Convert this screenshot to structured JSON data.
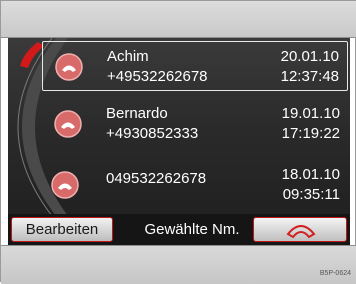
{
  "colors": {
    "accent": "#c01818",
    "screen": "#2a2a2a",
    "text": "#ffffff"
  },
  "calls": [
    {
      "name": "Achim",
      "number": "+49532262678",
      "date": "20.01.10",
      "time": "12:37:48",
      "selected": true,
      "icon": "phone-handset-icon"
    },
    {
      "name": "Bernardo",
      "number": "+4930852333",
      "date": "19.01.10",
      "time": "17:19:22",
      "selected": false,
      "icon": "phone-handset-icon"
    },
    {
      "name": "",
      "number": "049532262678",
      "date": "18.01.10",
      "time": "09:35:11",
      "selected": false,
      "icon": "phone-handset-icon"
    }
  ],
  "footer": {
    "edit_label": "Bearbeiten",
    "list_label": "Gewählte Nm.",
    "call_icon": "phone-handset-icon"
  },
  "image_code": "B5P-0624"
}
